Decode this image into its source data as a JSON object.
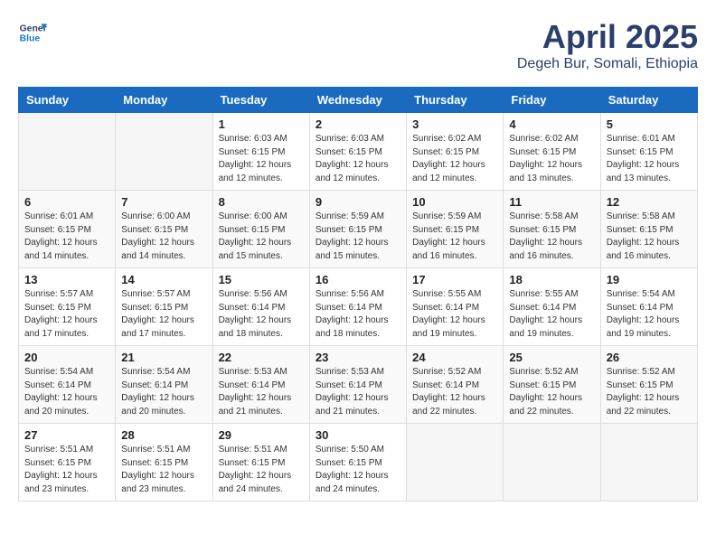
{
  "logo": {
    "line1": "General",
    "line2": "Blue"
  },
  "title": "April 2025",
  "location": "Degeh Bur, Somali, Ethiopia",
  "days_of_week": [
    "Sunday",
    "Monday",
    "Tuesday",
    "Wednesday",
    "Thursday",
    "Friday",
    "Saturday"
  ],
  "weeks": [
    [
      {
        "day": "",
        "info": ""
      },
      {
        "day": "",
        "info": ""
      },
      {
        "day": "1",
        "info": "Sunrise: 6:03 AM\nSunset: 6:15 PM\nDaylight: 12 hours\nand 12 minutes."
      },
      {
        "day": "2",
        "info": "Sunrise: 6:03 AM\nSunset: 6:15 PM\nDaylight: 12 hours\nand 12 minutes."
      },
      {
        "day": "3",
        "info": "Sunrise: 6:02 AM\nSunset: 6:15 PM\nDaylight: 12 hours\nand 12 minutes."
      },
      {
        "day": "4",
        "info": "Sunrise: 6:02 AM\nSunset: 6:15 PM\nDaylight: 12 hours\nand 13 minutes."
      },
      {
        "day": "5",
        "info": "Sunrise: 6:01 AM\nSunset: 6:15 PM\nDaylight: 12 hours\nand 13 minutes."
      }
    ],
    [
      {
        "day": "6",
        "info": "Sunrise: 6:01 AM\nSunset: 6:15 PM\nDaylight: 12 hours\nand 14 minutes."
      },
      {
        "day": "7",
        "info": "Sunrise: 6:00 AM\nSunset: 6:15 PM\nDaylight: 12 hours\nand 14 minutes."
      },
      {
        "day": "8",
        "info": "Sunrise: 6:00 AM\nSunset: 6:15 PM\nDaylight: 12 hours\nand 15 minutes."
      },
      {
        "day": "9",
        "info": "Sunrise: 5:59 AM\nSunset: 6:15 PM\nDaylight: 12 hours\nand 15 minutes."
      },
      {
        "day": "10",
        "info": "Sunrise: 5:59 AM\nSunset: 6:15 PM\nDaylight: 12 hours\nand 16 minutes."
      },
      {
        "day": "11",
        "info": "Sunrise: 5:58 AM\nSunset: 6:15 PM\nDaylight: 12 hours\nand 16 minutes."
      },
      {
        "day": "12",
        "info": "Sunrise: 5:58 AM\nSunset: 6:15 PM\nDaylight: 12 hours\nand 16 minutes."
      }
    ],
    [
      {
        "day": "13",
        "info": "Sunrise: 5:57 AM\nSunset: 6:15 PM\nDaylight: 12 hours\nand 17 minutes."
      },
      {
        "day": "14",
        "info": "Sunrise: 5:57 AM\nSunset: 6:15 PM\nDaylight: 12 hours\nand 17 minutes."
      },
      {
        "day": "15",
        "info": "Sunrise: 5:56 AM\nSunset: 6:14 PM\nDaylight: 12 hours\nand 18 minutes."
      },
      {
        "day": "16",
        "info": "Sunrise: 5:56 AM\nSunset: 6:14 PM\nDaylight: 12 hours\nand 18 minutes."
      },
      {
        "day": "17",
        "info": "Sunrise: 5:55 AM\nSunset: 6:14 PM\nDaylight: 12 hours\nand 19 minutes."
      },
      {
        "day": "18",
        "info": "Sunrise: 5:55 AM\nSunset: 6:14 PM\nDaylight: 12 hours\nand 19 minutes."
      },
      {
        "day": "19",
        "info": "Sunrise: 5:54 AM\nSunset: 6:14 PM\nDaylight: 12 hours\nand 19 minutes."
      }
    ],
    [
      {
        "day": "20",
        "info": "Sunrise: 5:54 AM\nSunset: 6:14 PM\nDaylight: 12 hours\nand 20 minutes."
      },
      {
        "day": "21",
        "info": "Sunrise: 5:54 AM\nSunset: 6:14 PM\nDaylight: 12 hours\nand 20 minutes."
      },
      {
        "day": "22",
        "info": "Sunrise: 5:53 AM\nSunset: 6:14 PM\nDaylight: 12 hours\nand 21 minutes."
      },
      {
        "day": "23",
        "info": "Sunrise: 5:53 AM\nSunset: 6:14 PM\nDaylight: 12 hours\nand 21 minutes."
      },
      {
        "day": "24",
        "info": "Sunrise: 5:52 AM\nSunset: 6:14 PM\nDaylight: 12 hours\nand 22 minutes."
      },
      {
        "day": "25",
        "info": "Sunrise: 5:52 AM\nSunset: 6:15 PM\nDaylight: 12 hours\nand 22 minutes."
      },
      {
        "day": "26",
        "info": "Sunrise: 5:52 AM\nSunset: 6:15 PM\nDaylight: 12 hours\nand 22 minutes."
      }
    ],
    [
      {
        "day": "27",
        "info": "Sunrise: 5:51 AM\nSunset: 6:15 PM\nDaylight: 12 hours\nand 23 minutes."
      },
      {
        "day": "28",
        "info": "Sunrise: 5:51 AM\nSunset: 6:15 PM\nDaylight: 12 hours\nand 23 minutes."
      },
      {
        "day": "29",
        "info": "Sunrise: 5:51 AM\nSunset: 6:15 PM\nDaylight: 12 hours\nand 24 minutes."
      },
      {
        "day": "30",
        "info": "Sunrise: 5:50 AM\nSunset: 6:15 PM\nDaylight: 12 hours\nand 24 minutes."
      },
      {
        "day": "",
        "info": ""
      },
      {
        "day": "",
        "info": ""
      },
      {
        "day": "",
        "info": ""
      }
    ]
  ]
}
